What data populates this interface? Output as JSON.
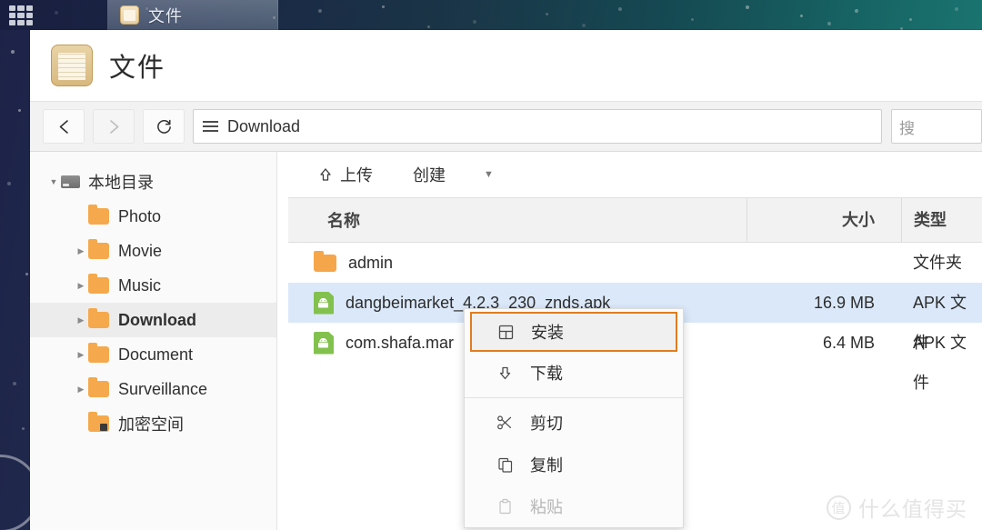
{
  "desktop": {
    "launcher_icon": "app-grid-icon",
    "taskbar_tabs": [
      {
        "label": "文件",
        "icon": "folder-icon",
        "active": true
      }
    ]
  },
  "window": {
    "app_icon": "file-manager-icon",
    "title": "文件",
    "nav": {
      "back_label": "‹",
      "forward_label": "›",
      "refresh_label": "↻",
      "path_menu_icon": "hamburger-icon",
      "path_value": "Download",
      "search_placeholder": "搜索",
      "search_label": "搜"
    }
  },
  "sidebar": {
    "items": [
      {
        "label": "本地目录",
        "icon": "hdd-icon",
        "caret": "down",
        "level": 0,
        "selected": false,
        "bold": false
      },
      {
        "label": "Photo",
        "icon": "folder-icon",
        "caret": "none",
        "level": 1,
        "selected": false,
        "bold": false
      },
      {
        "label": "Movie",
        "icon": "folder-icon",
        "caret": "right",
        "level": 1,
        "selected": false,
        "bold": false
      },
      {
        "label": "Music",
        "icon": "folder-icon",
        "caret": "right",
        "level": 1,
        "selected": false,
        "bold": false
      },
      {
        "label": "Download",
        "icon": "folder-icon",
        "caret": "right",
        "level": 1,
        "selected": true,
        "bold": true
      },
      {
        "label": "Document",
        "icon": "folder-icon",
        "caret": "right",
        "level": 1,
        "selected": false,
        "bold": false
      },
      {
        "label": "Surveillance",
        "icon": "folder-icon",
        "caret": "right",
        "level": 1,
        "selected": false,
        "bold": false
      },
      {
        "label": "加密空间",
        "icon": "folder-locked-icon",
        "caret": "none",
        "level": 1,
        "selected": false,
        "bold": false
      }
    ]
  },
  "toolbar": {
    "upload_label": "上传",
    "upload_icon": "upload-arrow-icon",
    "create_label": "创建",
    "create_caret_icon": "chevron-down-icon"
  },
  "table": {
    "columns": [
      "名称",
      "大小",
      "类型"
    ],
    "rows": [
      {
        "name": "admin",
        "size": "",
        "type": "文件夹",
        "icon": "folder-icon",
        "selected": false
      },
      {
        "name": "dangbeimarket_4.2.3_230_znds.apk",
        "size": "16.9 MB",
        "type": "APK 文件",
        "icon": "apk-icon",
        "selected": true
      },
      {
        "name": "com.shafa.mar",
        "size": "6.4 MB",
        "type": "APK 文件",
        "icon": "apk-icon",
        "selected": false
      }
    ]
  },
  "context_menu": {
    "items": [
      {
        "label": "安装",
        "icon": "install-icon",
        "highlight": true,
        "disabled": false
      },
      {
        "label": "下载",
        "icon": "download-arrow-icon",
        "highlight": false,
        "disabled": false
      },
      {
        "separator_after": true
      },
      {
        "label": "剪切",
        "icon": "scissors-icon",
        "highlight": false,
        "disabled": false
      },
      {
        "label": "复制",
        "icon": "copy-icon",
        "highlight": false,
        "disabled": false
      },
      {
        "label": "粘贴",
        "icon": "paste-icon",
        "highlight": false,
        "disabled": true
      }
    ]
  },
  "watermark": {
    "logo_char": "值",
    "text": "什么值得买"
  },
  "colors": {
    "selection": "#dae8f9",
    "highlight_border": "#e07d20",
    "folder": "#f6a64a",
    "apk": "#82c14e"
  }
}
